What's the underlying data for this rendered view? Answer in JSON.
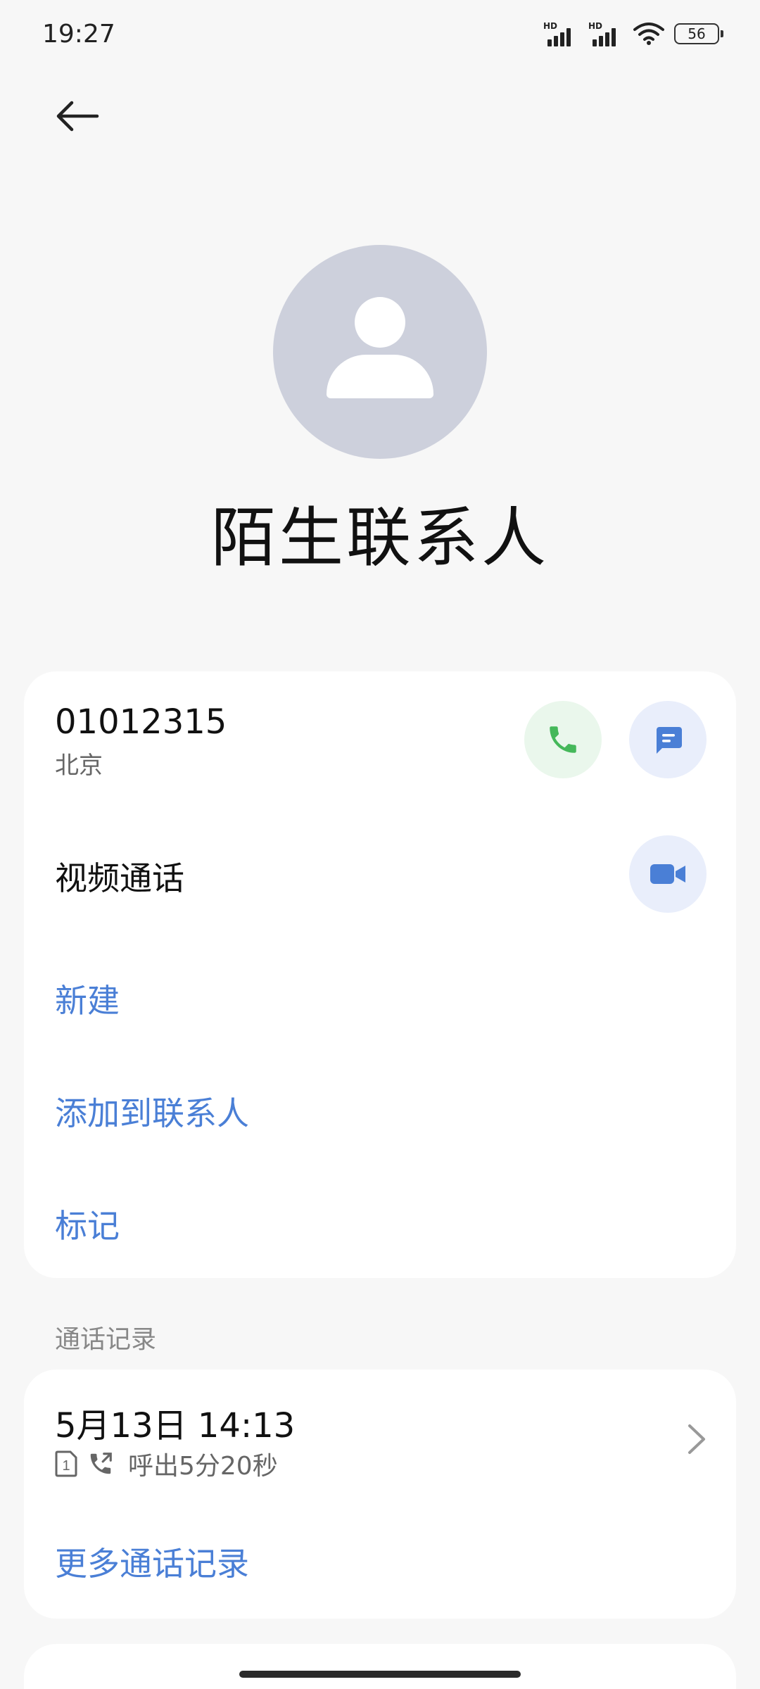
{
  "status_bar": {
    "time": "19:27",
    "signal1_label": "HD",
    "signal2_label": "HD",
    "battery": "56"
  },
  "header": {
    "back_icon": "arrow-left-icon"
  },
  "contact": {
    "avatar_icon": "person-icon",
    "name": "陌生联系人"
  },
  "main_card": {
    "phone_number": "01012315",
    "location": "北京",
    "call_icon": "phone-icon",
    "message_icon": "message-icon",
    "video_call_label": "视频通话",
    "video_icon": "video-camera-icon",
    "new_label": "新建",
    "add_to_contacts_label": "添加到联系人",
    "mark_label": "标记"
  },
  "call_log": {
    "section_title": "通话记录",
    "entries": [
      {
        "datetime": "5月13日 14:13",
        "sim": "1",
        "detail": "呼出5分20秒"
      }
    ],
    "more_label": "更多通话记录"
  },
  "colors": {
    "accent_blue": "#4a7fd6",
    "call_green": "#45b85a",
    "danger_red": "#d9352b",
    "avatar_gray": "#cdd0dc"
  }
}
